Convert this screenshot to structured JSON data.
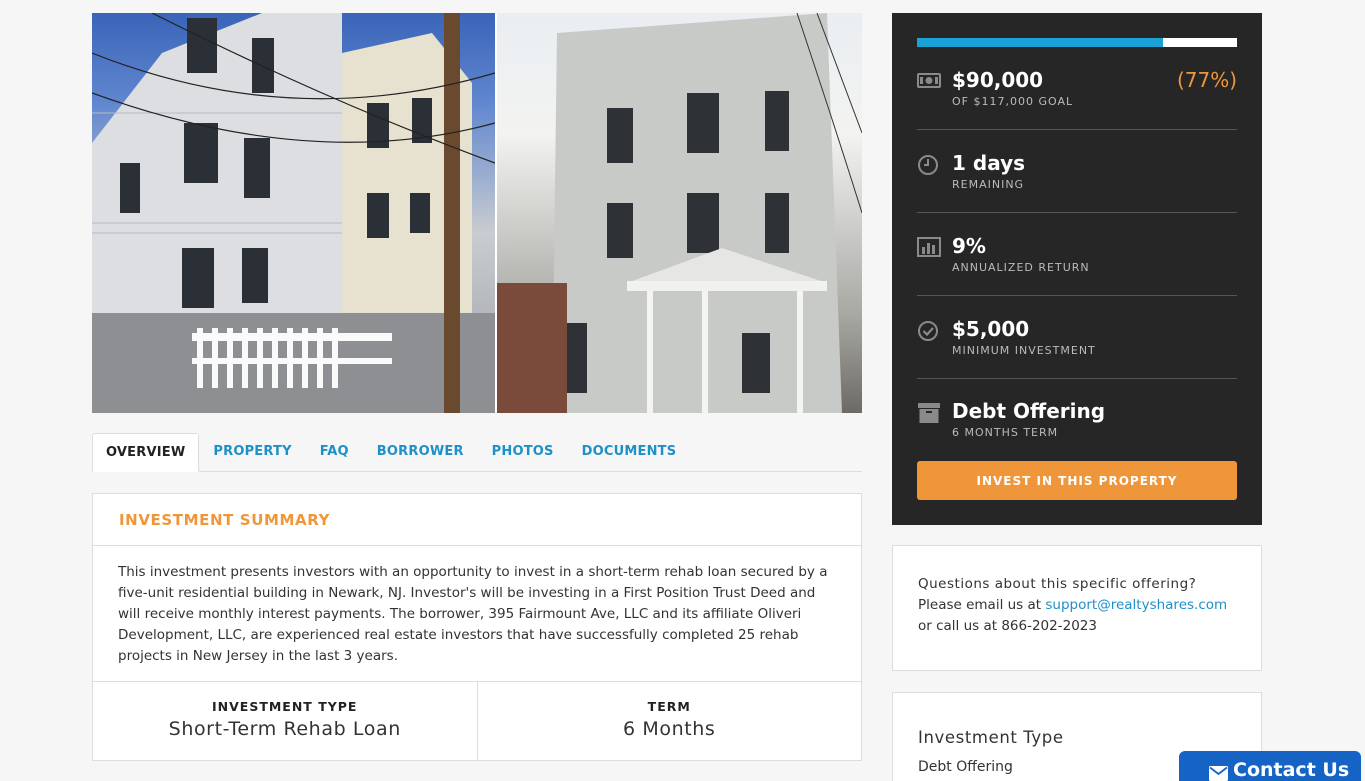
{
  "tabs": [
    "OVERVIEW",
    "PROPERTY",
    "FAQ",
    "BORROWER",
    "PHOTOS",
    "DOCUMENTS"
  ],
  "summary": {
    "title": "INVESTMENT SUMMARY",
    "body": "This investment presents investors with an opportunity to invest in a short-term rehab loan secured by a five-unit residential building in Newark, NJ. Investor's will be investing in a First Position Trust Deed and will receive monthly interest payments. The borrower, 395 Fairmount Ave, LLC and its affiliate Oliveri Development, LLC, are experienced real estate investors that have successfully completed 25 rehab projects in New Jersey in the last 3 years.",
    "meta": [
      {
        "label": "INVESTMENT TYPE",
        "value": "Short-Term Rehab Loan"
      },
      {
        "label": "TERM",
        "value": "6 Months"
      }
    ]
  },
  "stats": {
    "progress_fraction": 0.77,
    "raised": "$90,000",
    "goal": "OF $117,000 GOAL",
    "percent": "(77%)",
    "days": "1 days",
    "days_label": "REMAINING",
    "return": "9%",
    "return_label": "ANNUALIZED RETURN",
    "minimum": "$5,000",
    "minimum_label": "MINIMUM INVESTMENT",
    "offering": "Debt Offering",
    "offering_label": "6 MONTHS TERM",
    "invest_button": "INVEST IN THIS PROPERTY"
  },
  "questions": {
    "title": "Questions about this specific offering?",
    "email_prefix": "Please email us at",
    "email": "support@realtyshares.com",
    "phone_line": "or call us at 866-202-2023"
  },
  "investment_type_card": {
    "title": "Investment Type",
    "value": "Debt Offering"
  },
  "contact_button": "Contact Us",
  "colors": {
    "accent_orange": "#f0963a",
    "accent_blue": "#1aa1d6",
    "link_blue": "#1e90c8",
    "panel_dark": "#262626",
    "contact_blue": "#1663c6"
  },
  "icons": [
    "money-icon",
    "clock-icon",
    "bar-chart-icon",
    "check-circle-icon",
    "archive-icon",
    "envelope-icon"
  ]
}
